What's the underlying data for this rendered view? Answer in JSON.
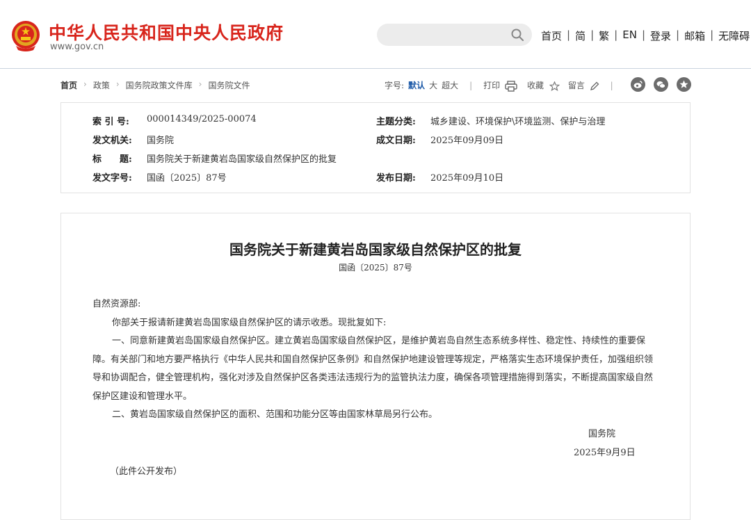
{
  "header": {
    "site_name": "中华人民共和国中央人民政府",
    "site_domain": "www.gov.cn",
    "search": {
      "placeholder": ""
    },
    "nav": [
      "首页",
      "简",
      "繁",
      "EN",
      "登录",
      "邮箱",
      "无障碍"
    ],
    "nav_separator": "|",
    "brand_color": "#d8251c"
  },
  "breadcrumb": {
    "items": [
      "首页",
      "政策",
      "国务院政策文件库",
      "国务院文件"
    ],
    "arrow": "›"
  },
  "toolbar": {
    "font_size_label": "字号:",
    "font_sizes": [
      "默认",
      "大",
      "超大"
    ],
    "active_font_size": "默认",
    "print": "打印",
    "favorite": "收藏",
    "comment": "留言",
    "share_icons": [
      "weibo-icon",
      "wechat-icon",
      "star-share-icon"
    ],
    "accent_color": "#1d5aa8"
  },
  "meta": {
    "index_label": "索 引 号:",
    "index_value": "000014349/2025-00074",
    "issuer_label": "发文机关:",
    "issuer_value": "国务院",
    "title_label": "标　　题:",
    "title_value": "国务院关于新建黄岩岛国家级自然保护区的批复",
    "docno_label": "发文字号:",
    "docno_value": "国函〔2025〕87号",
    "topic_label": "主题分类:",
    "topic_value": "城乡建设、环境保护\\环境监测、保护与治理",
    "written_label": "成文日期:",
    "written_value": "2025年09月09日",
    "published_label": "发布日期:",
    "published_value": "2025年09月10日"
  },
  "document": {
    "title": "国务院关于新建黄岩岛国家级自然保护区的批复",
    "number": "国函〔2025〕87号",
    "salutation": "自然资源部:",
    "paragraphs": [
      "你部关于报请新建黄岩岛国家级自然保护区的请示收悉。现批复如下:",
      "一、同意新建黄岩岛国家级自然保护区。建立黄岩岛国家级自然保护区，是维护黄岩岛自然生态系统多样性、稳定性、持续性的重要保障。有关部门和地方要严格执行《中华人民共和国自然保护区条例》和自然保护地建设管理等规定，严格落实生态环境保护责任，加强组织领导和协调配合，健全管理机构，强化对涉及自然保护区各类违法违规行为的监管执法力度，确保各项管理措施得到落实，不断提高国家级自然保护区建设和管理水平。",
      "二、黄岩岛国家级自然保护区的面积、范围和功能分区等由国家林草局另行公布。"
    ],
    "signature": "国务院",
    "date": "2025年9月9日",
    "footnote": "（此件公开发布）"
  }
}
